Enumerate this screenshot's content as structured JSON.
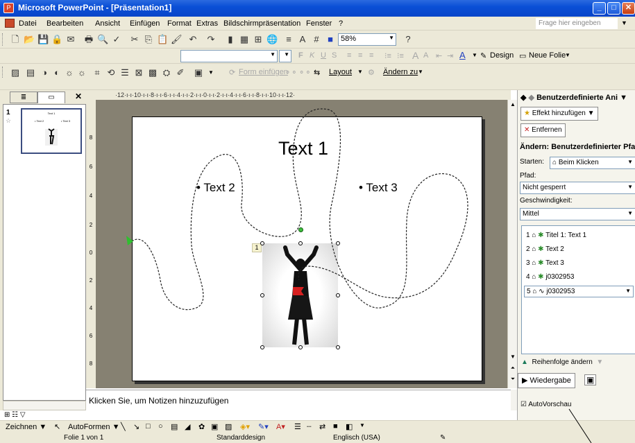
{
  "window": {
    "title": "Microsoft PowerPoint - [Präsentation1]"
  },
  "menu": {
    "items": [
      "Datei",
      "Bearbeiten",
      "Ansicht",
      "Einfügen",
      "Format",
      "Extras",
      "Bildschirmpräsentation",
      "Fenster",
      "?"
    ],
    "help_placeholder": "Frage hier eingeben"
  },
  "toolbar": {
    "zoom": "58%",
    "design_label": "Design",
    "new_slide_label": "Neue Folie",
    "form_insert_label": "Form einfügen",
    "layout_label": "Layout",
    "change_to_label": "Ändern zu"
  },
  "slide_panel": {
    "slide_number": "1",
    "thumb_title": "Text 1"
  },
  "slide": {
    "title": "Text 1",
    "bullets": [
      "Text 2",
      "Text 3"
    ],
    "sequence_tag": "1"
  },
  "notes": {
    "placeholder": "Klicken Sie, um Notizen hinzuzufügen"
  },
  "taskpane": {
    "title": "Benutzerdefinierte Ani",
    "add_effect": "Effekt hinzufügen",
    "remove": "Entfernen",
    "change_heading": "Ändern: Benutzerdefinierter Pfad",
    "start_label": "Starten:",
    "start_value": "Beim Klicken",
    "path_label": "Pfad:",
    "path_value": "Nicht gesperrt",
    "speed_label": "Geschwindigkeit:",
    "speed_value": "Mittel",
    "list": [
      {
        "num": "1",
        "name": "Titel 1: Text 1"
      },
      {
        "num": "2",
        "name": "Text 2"
      },
      {
        "num": "3",
        "name": "Text 3"
      },
      {
        "num": "4",
        "name": "j0302953"
      },
      {
        "num": "5",
        "name": "j0302953"
      }
    ],
    "reorder_label": "Reihenfolge ändern",
    "play_label": "Wiedergabe",
    "autopreview_label": "AutoVorschau"
  },
  "drawbar": {
    "draw_label": "Zeichnen",
    "autoshapes_label": "AutoFormen"
  },
  "status": {
    "slide": "Folie 1 von 1",
    "design": "Standarddesign",
    "language": "Englisch (USA)"
  },
  "colors": {
    "titlebar": "#0a4fd6",
    "path_start": "#2fbf2f",
    "path_end": "#d62020",
    "slide_bg": "#868172"
  }
}
